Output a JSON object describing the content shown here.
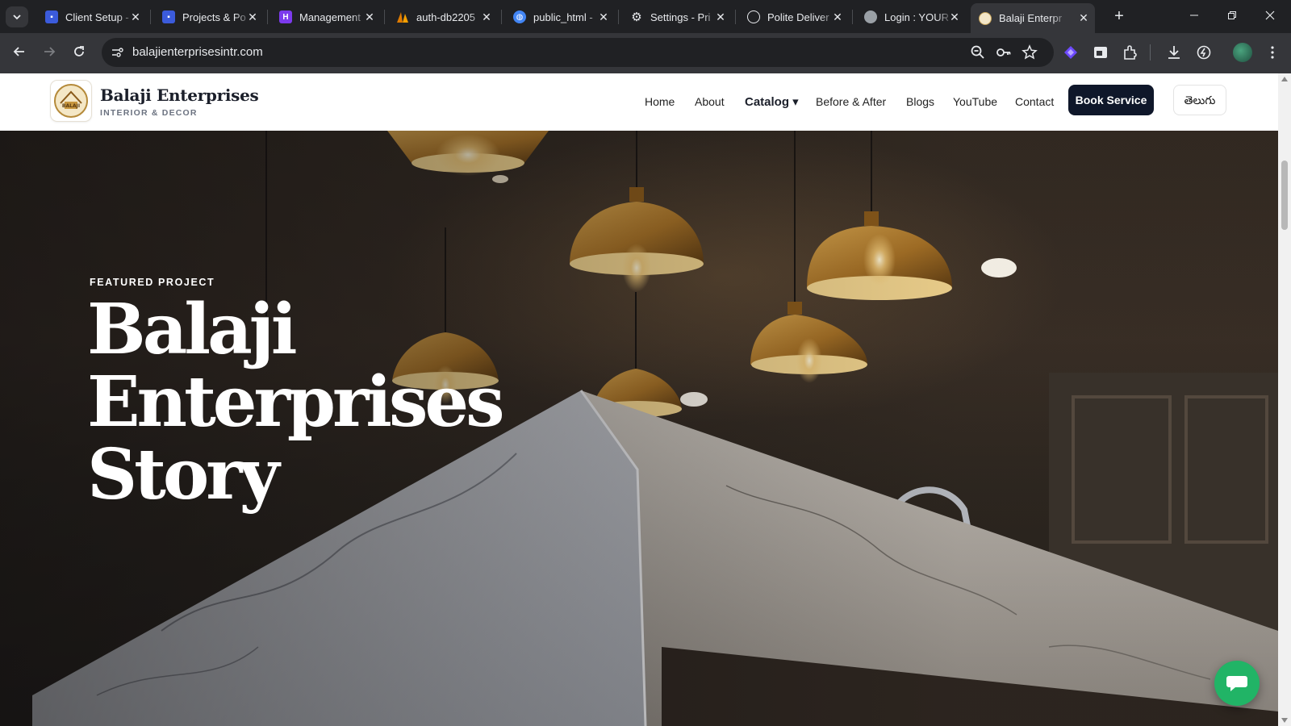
{
  "browser": {
    "tabs": [
      {
        "label": "Client Setup -",
        "icon": "document-icon",
        "color": "#3b5bdb"
      },
      {
        "label": "Projects & Po",
        "icon": "document-icon",
        "color": "#3b5bdb"
      },
      {
        "label": "Management",
        "icon": "h-logo-icon",
        "color": "#7c3aed"
      },
      {
        "label": "auth-db2205",
        "icon": "sails-logo-icon",
        "color": "#e07b00"
      },
      {
        "label": "public_html -",
        "icon": "globe-icon",
        "color": "#4285f4"
      },
      {
        "label": "Settings - Pri",
        "icon": "gear-icon",
        "color": "#e8eaed"
      },
      {
        "label": "Polite Deliver",
        "icon": "openai-icon",
        "color": "#e8eaed"
      },
      {
        "label": "Login : YOUR",
        "icon": "globe-icon",
        "color": "#9aa0a6"
      },
      {
        "label": "Balaji Enterpr",
        "icon": "site-favicon",
        "color": "#c7a45a"
      }
    ],
    "close_glyph": "✕",
    "new_tab_glyph": "+",
    "url": "balajienterprisesintr.com"
  },
  "site": {
    "brand": {
      "name": "Balaji Enterprises",
      "tagline": "INTERIOR & DECOR",
      "logo_text": "BALAJI"
    },
    "nav": {
      "home": "Home",
      "about": "About",
      "catalog": "Catalog ▾",
      "before_after": "Before & After",
      "blogs": "Blogs",
      "youtube": "YouTube",
      "contact": "Contact"
    },
    "book_button": "Book Service",
    "language_button": "తెలుగు",
    "hero": {
      "eyebrow": "FEATURED PROJECT",
      "title_line1": "Balaji",
      "title_line2": "Enterprises",
      "title_line3": "Story"
    }
  },
  "colors": {
    "accent_dark": "#0f172a",
    "chat_green": "#21b466"
  }
}
